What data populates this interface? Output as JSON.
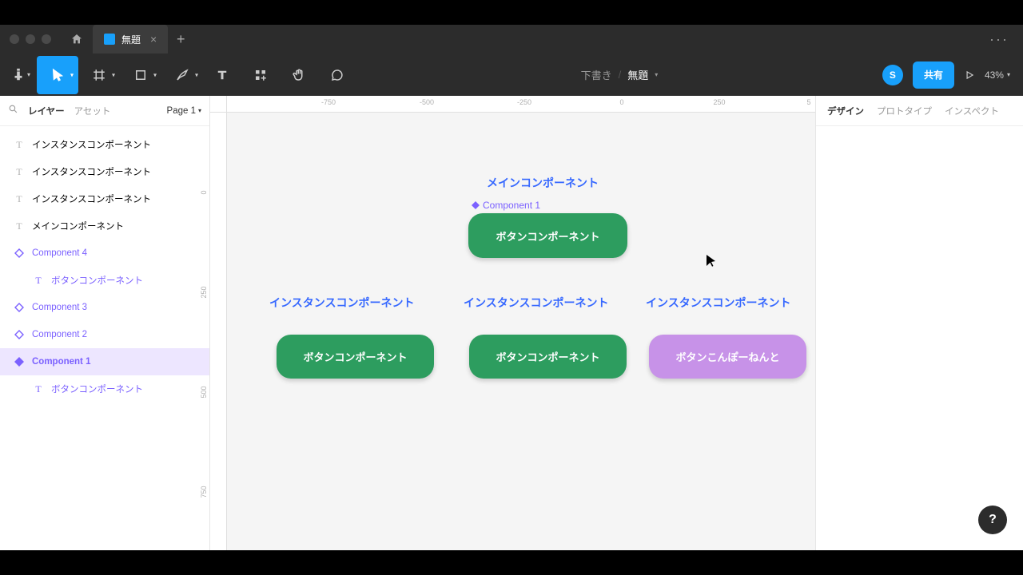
{
  "titlebar": {
    "tab_name": "無題"
  },
  "toolbar": {
    "breadcrumb_draft": "下書き",
    "breadcrumb_file": "無題",
    "avatar_letter": "S",
    "share_label": "共有",
    "zoom": "43%"
  },
  "left_panel": {
    "tab_layers": "レイヤー",
    "tab_assets": "アセット",
    "page_label": "Page 1",
    "layers": [
      {
        "name": "インスタンスコンポーネント",
        "type": "text",
        "indent": 0
      },
      {
        "name": "インスタンスコンポーネント",
        "type": "text",
        "indent": 0
      },
      {
        "name": "インスタンスコンポーネント",
        "type": "text",
        "indent": 0
      },
      {
        "name": "メインコンポーネント",
        "type": "text",
        "indent": 0
      },
      {
        "name": "Component 4",
        "type": "instance",
        "indent": 0,
        "purple": true
      },
      {
        "name": "ボタンコンポーネント",
        "type": "text",
        "indent": 1,
        "purple": true
      },
      {
        "name": "Component 3",
        "type": "instance",
        "indent": 0,
        "purple": true
      },
      {
        "name": "Component 2",
        "type": "instance",
        "indent": 0,
        "purple": true
      },
      {
        "name": "Component 1",
        "type": "component",
        "indent": 0,
        "purple": true,
        "selected": true
      },
      {
        "name": "ボタンコンポーネント",
        "type": "text",
        "indent": 1,
        "purple": true
      }
    ]
  },
  "canvas": {
    "ruler_h": [
      "-750",
      "-500",
      "-250",
      "0",
      "250",
      "5"
    ],
    "ruler_v": [
      "0",
      "250",
      "500",
      "750"
    ],
    "main_label": "メインコンポーネント",
    "component1_label": "Component 1",
    "main_button": "ボタンコンポーネント",
    "instance_label_1": "インスタンスコンポーネント",
    "instance_label_2": "インスタンスコンポーネント",
    "instance_label_3": "インスタンスコンポーネント",
    "instance_btn_1": "ボタンコンポーネント",
    "instance_btn_2": "ボタンコンポーネント",
    "instance_btn_3": "ボタンこんぽーねんと"
  },
  "right_panel": {
    "tab_design": "デザイン",
    "tab_prototype": "プロトタイプ",
    "tab_inspect": "インスペクト"
  },
  "help": "?"
}
